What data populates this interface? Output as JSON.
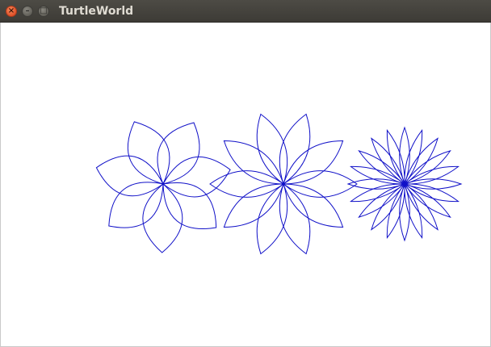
{
  "window": {
    "title": "TurtleWorld",
    "buttons": {
      "close_glyph": "×",
      "minimize_glyph": "–",
      "maximize_glyph": "□"
    }
  },
  "colors": {
    "stroke": "#1010c8",
    "canvas_bg": "#ffffff",
    "titlebar": "#3d3b36"
  },
  "canvas": {
    "flowers": [
      {
        "name": "flower-7-petals",
        "petals": 7,
        "petal_span": 3.2,
        "rotation": 12
      },
      {
        "name": "flower-10-petals",
        "petals": 10,
        "petal_span": 2.0,
        "rotation": 72
      },
      {
        "name": "flower-20-petals",
        "petals": 20,
        "petal_span": 1.0,
        "rotation": 0
      }
    ]
  }
}
